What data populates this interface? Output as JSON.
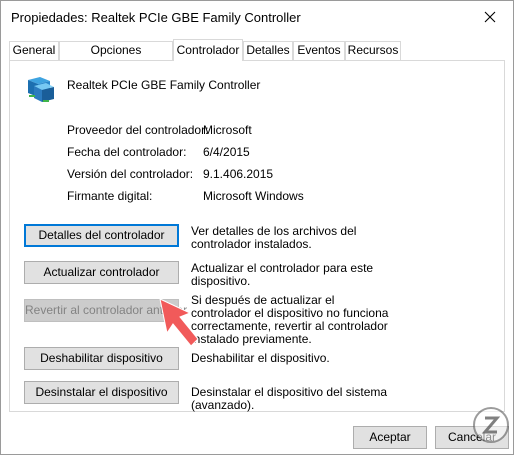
{
  "window": {
    "title": "Propiedades: Realtek PCIe GBE Family Controller"
  },
  "tabs": [
    {
      "label": "General"
    },
    {
      "label": "Opciones avanzadas"
    },
    {
      "label": "Controlador"
    },
    {
      "label": "Detalles"
    },
    {
      "label": "Eventos"
    },
    {
      "label": "Recursos"
    }
  ],
  "active_tab": "Controlador",
  "device": {
    "name": "Realtek PCIe GBE Family Controller",
    "icon": "network-adapter-icon"
  },
  "info": {
    "provider_label": "Proveedor del controlador:",
    "provider_value": "Microsoft",
    "date_label": "Fecha del controlador:",
    "date_value": "6/4/2015",
    "version_label": "Versión del controlador:",
    "version_value": "9.1.406.2015",
    "signer_label": "Firmante digital:",
    "signer_value": "Microsoft Windows"
  },
  "actions": {
    "details_button": "Detalles del controlador",
    "details_desc": "Ver detalles de los archivos del controlador instalados.",
    "update_button": "Actualizar controlador",
    "update_desc": "Actualizar el controlador para este dispositivo.",
    "rollback_button": "Revertir al controlador anterior",
    "rollback_desc": "Si después de actualizar el controlador el dispositivo no funciona correctamente, revertir al controlador instalado previamente.",
    "disable_button": "Deshabilitar dispositivo",
    "disable_desc": "Deshabilitar el dispositivo.",
    "uninstall_button": "Desinstalar el dispositivo",
    "uninstall_desc": "Desinstalar el dispositivo del sistema (avanzado)."
  },
  "footer": {
    "ok_button": "Aceptar",
    "cancel_button": "Cancelar"
  },
  "colors": {
    "focus_border": "#0078d7",
    "arrow": "#f15a5a"
  }
}
